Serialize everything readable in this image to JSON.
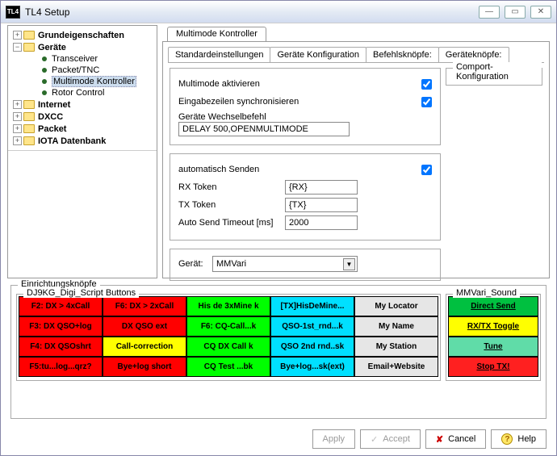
{
  "window": {
    "title": "TL4 Setup",
    "icon_text": "TL4"
  },
  "tree": {
    "items": [
      {
        "label": "Grundeigenschaften",
        "expander": "+",
        "bold": true,
        "level": 1
      },
      {
        "label": "Geräte",
        "expander": "−",
        "bold": true,
        "level": 1
      },
      {
        "label": "Transceiver",
        "child": true
      },
      {
        "label": "Packet/TNC",
        "child": true
      },
      {
        "label": "Multimode Kontroller",
        "child": true,
        "selected": true
      },
      {
        "label": "Rotor Control",
        "child": true
      },
      {
        "label": "Internet",
        "expander": "+",
        "bold": true,
        "level": 1
      },
      {
        "label": "DXCC",
        "expander": "+",
        "bold": true,
        "level": 1
      },
      {
        "label": "Packet",
        "expander": "+",
        "bold": true,
        "level": 1
      },
      {
        "label": "IOTA Datenbank",
        "expander": "+",
        "bold": true,
        "level": 1
      }
    ]
  },
  "outer_tab": "Multimode Kontroller",
  "subtabs": [
    "Standardeinstellungen",
    "Geräte Konfiguration",
    "Befehlsknöpfe:",
    "Geräteknöpfe:"
  ],
  "form": {
    "activate": {
      "label": "Multimode aktivieren",
      "checked": true
    },
    "sync": {
      "label": "Eingabezeilen synchronisieren",
      "checked": true
    },
    "change_cmd": {
      "label": "Geräte Wechselbefehl",
      "value": "DELAY 500,OPENMULTIMODE"
    },
    "autosend": {
      "label": "automatisch Senden",
      "checked": true
    },
    "rx": {
      "label": "RX Token",
      "value": "{RX}"
    },
    "tx": {
      "label": "TX Token",
      "value": "{TX}"
    },
    "timeout": {
      "label": "Auto Send Timeout [ms]",
      "value": "2000"
    },
    "device": {
      "label": "Gerät:",
      "value": "MMVari"
    },
    "comport_title": "Comport-Konfiguration"
  },
  "einr": {
    "title": "Einrichtungsknöpfe",
    "script_title": "DJ9KG_Digi_Script Buttons",
    "sound_title": "MMVari_Sound",
    "grid": [
      [
        {
          "t": "F2: DX > 4xCall",
          "c": "red"
        },
        {
          "t": "F6: DX > 2xCall",
          "c": "red"
        },
        {
          "t": "His de 3xMine k",
          "c": "green"
        },
        {
          "t": "[TX]HisDeMine...",
          "c": "cyan"
        },
        {
          "t": "My Locator",
          "c": "grey"
        }
      ],
      [
        {
          "t": "F3: DX QSO+log",
          "c": "red"
        },
        {
          "t": "DX QSO ext",
          "c": "red"
        },
        {
          "t": "F6: CQ-Call...k",
          "c": "green"
        },
        {
          "t": "QSO-1st_rnd...k",
          "c": "cyan"
        },
        {
          "t": "My Name",
          "c": "grey"
        }
      ],
      [
        {
          "t": "F4: DX QSOshrt",
          "c": "red"
        },
        {
          "t": "Call-correction",
          "c": "yellow"
        },
        {
          "t": "CQ DX Call k",
          "c": "green"
        },
        {
          "t": "QSO 2nd rnd..sk",
          "c": "cyan"
        },
        {
          "t": "My Station",
          "c": "grey"
        }
      ],
      [
        {
          "t": "F5:tu...log...qrz?",
          "c": "red"
        },
        {
          "t": "Bye+log short",
          "c": "red"
        },
        {
          "t": "CQ Test ...bk",
          "c": "green"
        },
        {
          "t": "Bye+log...sk(ext)",
          "c": "cyan"
        },
        {
          "t": "Email+Website",
          "c": "grey"
        }
      ]
    ],
    "sound": [
      {
        "t": "Direct Send",
        "c": "sgrn"
      },
      {
        "t": "RX/TX Toggle",
        "c": "sylw"
      },
      {
        "t": "Tune",
        "c": "slgn"
      },
      {
        "t": "Stop TX!",
        "c": "sred"
      }
    ]
  },
  "footer": {
    "apply": "Apply",
    "accept": "Accept",
    "cancel": "Cancel",
    "help": "Help"
  }
}
